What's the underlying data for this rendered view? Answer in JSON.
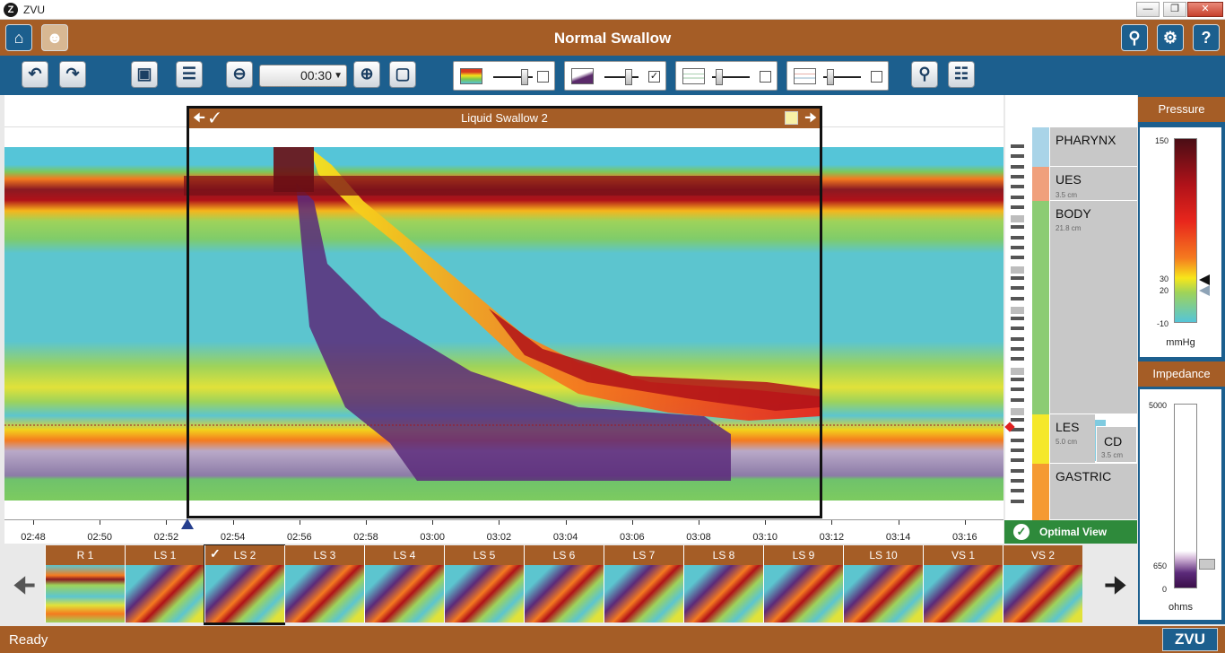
{
  "window": {
    "title": "ZVU",
    "app_logo": "Z"
  },
  "header": {
    "title": "Normal Swallow"
  },
  "icons": {
    "home": "home-icon",
    "patient": "patient-icon",
    "location": "location-icon",
    "settings": "gear-icon",
    "help": "help-icon",
    "undo": "undo-icon",
    "redo": "redo-icon",
    "save": "save-icon",
    "list": "list-icon",
    "zoom_out": "zoom-out-icon",
    "zoom_in": "zoom-in-icon",
    "fit": "fit-icon",
    "search": "search-icon",
    "clipboard": "clipboard-icon"
  },
  "toolbar": {
    "zoom_value": "00:30",
    "sliders": [
      {
        "name": "pressure-topography",
        "level": 0.8,
        "checked": false
      },
      {
        "name": "impedance-overlay",
        "level": 0.7,
        "checked": true
      },
      {
        "name": "line-trace",
        "level": 0.2,
        "checked": false
      },
      {
        "name": "line-trace-2",
        "level": 0.2,
        "checked": false
      }
    ]
  },
  "swallow": {
    "title": "Liquid Swallow 2"
  },
  "time_axis": {
    "ticks": [
      "02:48",
      "02:50",
      "02:52",
      "02:54",
      "02:56",
      "02:58",
      "03:00",
      "03:02",
      "03:04",
      "03:06",
      "03:08",
      "03:10",
      "03:12",
      "03:14",
      "03:16"
    ]
  },
  "anatomy": {
    "regions": [
      {
        "name": "PHARYNX",
        "sub": ""
      },
      {
        "name": "UES",
        "sub": "3.5 cm"
      },
      {
        "name": "BODY",
        "sub": "21.8 cm"
      },
      {
        "name": "LES",
        "sub": "5.0 cm"
      },
      {
        "name": "GASTRIC",
        "sub": ""
      }
    ],
    "cd": {
      "name": "CD",
      "sub": "3.5 cm"
    },
    "optimal_view": "Optimal View"
  },
  "pressure_legend": {
    "title": "Pressure",
    "ticks": [
      "150",
      "30",
      "20",
      "-10"
    ],
    "unit": "mmHg",
    "colors": [
      "#4a0d15",
      "#b01219",
      "#e8261c",
      "#f57a1f",
      "#f7e61b",
      "#9ed35a",
      "#55c5d8"
    ]
  },
  "impedance_legend": {
    "title": "Impedance",
    "ticks": [
      "5000",
      "650",
      "0"
    ],
    "unit": "ohms"
  },
  "thumbnails": [
    {
      "label": "R 1",
      "selected": false,
      "checked": false
    },
    {
      "label": "LS 1",
      "selected": false,
      "checked": false
    },
    {
      "label": "LS 2",
      "selected": true,
      "checked": true
    },
    {
      "label": "LS 3",
      "selected": false,
      "checked": false
    },
    {
      "label": "LS 4",
      "selected": false,
      "checked": false
    },
    {
      "label": "LS 5",
      "selected": false,
      "checked": false
    },
    {
      "label": "LS 6",
      "selected": false,
      "checked": false
    },
    {
      "label": "LS 7",
      "selected": false,
      "checked": false
    },
    {
      "label": "LS 8",
      "selected": false,
      "checked": false
    },
    {
      "label": "LS 9",
      "selected": false,
      "checked": false
    },
    {
      "label": "LS 10",
      "selected": false,
      "checked": false
    },
    {
      "label": "VS 1",
      "selected": false,
      "checked": false
    },
    {
      "label": "VS 2",
      "selected": false,
      "checked": false
    }
  ],
  "status": {
    "text": "Ready",
    "brand": "ZVU"
  }
}
